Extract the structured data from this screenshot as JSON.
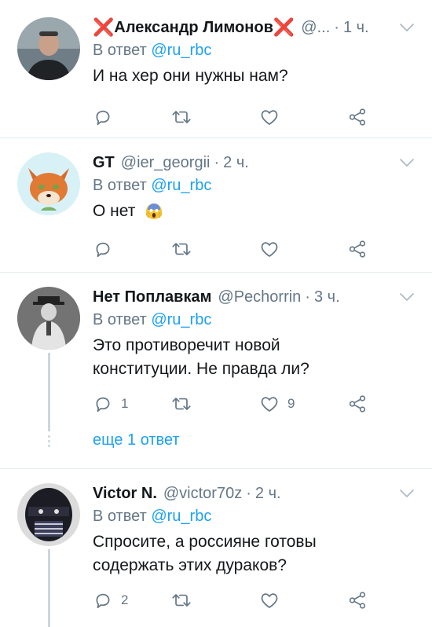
{
  "tweets": [
    {
      "name": "Александр Лимонов",
      "name_prefix": "❌",
      "name_suffix": "❌",
      "handle": "@...",
      "time": "1 ч.",
      "reply_prefix": "В ответ",
      "reply_handle": "@ru_rbc",
      "text": "И на хер они нужны нам?",
      "reply_count": "",
      "like_count": ""
    },
    {
      "name": "GT",
      "handle": "@ier_georgii",
      "time": "2 ч.",
      "reply_prefix": "В ответ",
      "reply_handle": "@ru_rbc",
      "text": "О нет",
      "reply_count": "",
      "like_count": ""
    },
    {
      "name": "Нет Поплавкам",
      "handle": "@Pechorrin",
      "time": "3 ч.",
      "reply_prefix": "В ответ",
      "reply_handle": "@ru_rbc",
      "text": "Это противоречит новой конституции. Не правда ли?",
      "reply_count": "1",
      "like_count": "9",
      "more_replies": "еще 1 ответ"
    },
    {
      "name": "Victor N.",
      "handle": "@victor70z",
      "time": "2 ч.",
      "reply_prefix": "В ответ",
      "reply_handle": "@ru_rbc",
      "text": "Спросите, а россияне готовы содержать этих дураков?",
      "reply_count": "2",
      "like_count": ""
    }
  ],
  "separator": "·",
  "icons": [
    "reply-icon",
    "retweet-icon",
    "like-icon",
    "share-icon",
    "chevron-down-icon"
  ],
  "colors": {
    "accent": "#1da1f2",
    "muted": "#657786",
    "text": "#14171a",
    "divider": "#e6ecf0",
    "cross": "#e0252b"
  }
}
